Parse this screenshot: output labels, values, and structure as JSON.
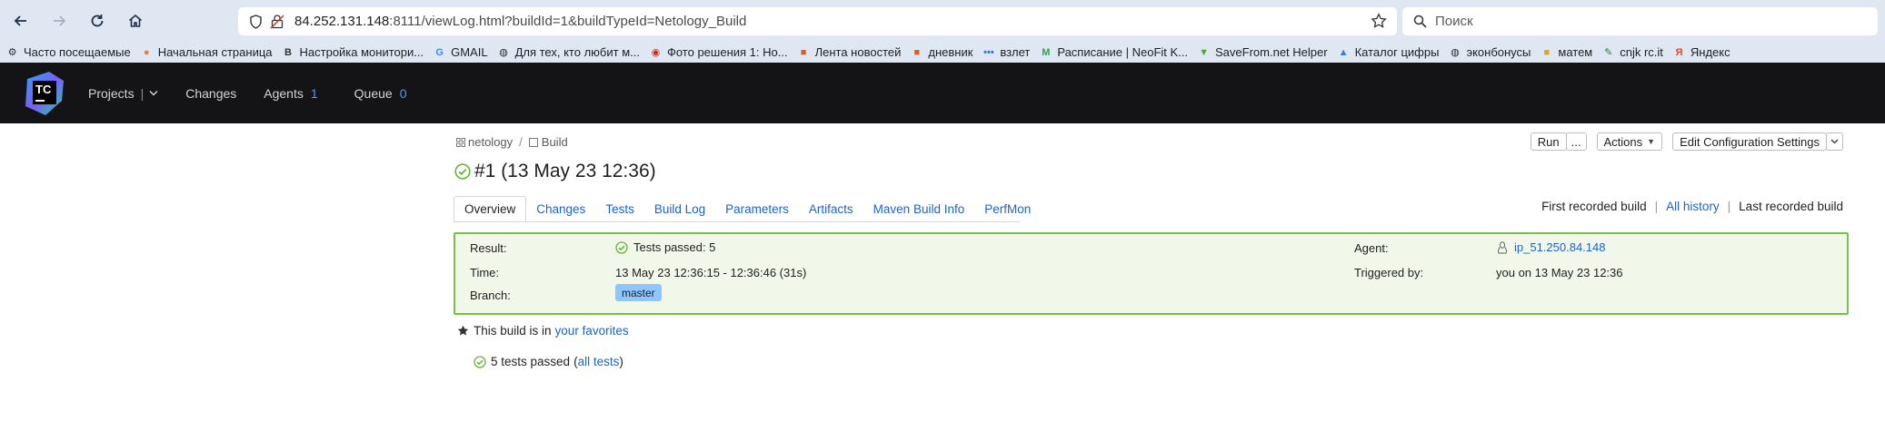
{
  "browser": {
    "url_host": "84.252.131.148",
    "url_rest": ":8111/viewLog.html?buildId=1&buildTypeId=Netology_Build",
    "search_placeholder": "Поиск"
  },
  "bookmarks": [
    {
      "label": "Часто посещаемые",
      "icon": "gear-icon",
      "color": "#2b2b2b"
    },
    {
      "label": "Начальная страница",
      "icon": "firefox-icon",
      "color": "#ff7139"
    },
    {
      "label": "Настройка монитори...",
      "icon": "b-icon",
      "color": "#333333"
    },
    {
      "label": "GMAIL",
      "icon": "google-icon",
      "color": "#4285f4"
    },
    {
      "label": "Для тех, кто любит м...",
      "icon": "globe-icon",
      "color": "#2b2b2b"
    },
    {
      "label": "Фото решения 1: Но...",
      "icon": "flag-icon",
      "color": "#d52b1e"
    },
    {
      "label": "Лента новостей",
      "icon": "news-icon",
      "color": "#e05a2b"
    },
    {
      "label": "дневник",
      "icon": "diary-icon",
      "color": "#e05a2b"
    },
    {
      "label": "взлет",
      "icon": "dots-icon",
      "color": "#3a6fd8"
    },
    {
      "label": "Расписание | NeoFit K...",
      "icon": "neofit-icon",
      "color": "#2ea44f"
    },
    {
      "label": "SaveFrom.net Helper",
      "icon": "download-icon",
      "color": "#4caf20"
    },
    {
      "label": "Каталог цифры",
      "icon": "catalog-icon",
      "color": "#3a7bd5"
    },
    {
      "label": "эконбонусы",
      "icon": "globe-icon",
      "color": "#2b2b2b"
    },
    {
      "label": "матем",
      "icon": "math-icon",
      "color": "#e0a800"
    },
    {
      "label": "cnjk rc.it",
      "icon": "leaf-icon",
      "color": "#2e7d32"
    },
    {
      "label": "Яндекс",
      "icon": "yandex-icon",
      "color": "#fc3f1d"
    }
  ],
  "teamcity": {
    "logo_text": "TC",
    "nav": {
      "projects": "Projects",
      "separator": "|",
      "changes": "Changes",
      "agents": "Agents",
      "agents_count": "1",
      "queue": "Queue",
      "queue_count": "0"
    }
  },
  "breadcrumb": {
    "project": "netology",
    "separator": "/",
    "build_config": "Build"
  },
  "build": {
    "title": "#1 (13 May 23 12:36)",
    "status_color": "#5fb832"
  },
  "top_buttons": {
    "run": "Run",
    "run_more": "...",
    "actions": "Actions",
    "edit": "Edit Configuration Settings"
  },
  "tabs": [
    {
      "label": "Overview",
      "active": true
    },
    {
      "label": "Changes",
      "active": false
    },
    {
      "label": "Tests",
      "active": false
    },
    {
      "label": "Build Log",
      "active": false
    },
    {
      "label": "Parameters",
      "active": false
    },
    {
      "label": "Artifacts",
      "active": false
    },
    {
      "label": "Maven Build Info",
      "active": false
    },
    {
      "label": "PerfMon",
      "active": false
    }
  ],
  "history_links": {
    "first": "First recorded build",
    "sep": "|",
    "all": "All history",
    "last": "Last recorded build"
  },
  "summary": {
    "result_label": "Result:",
    "result_value": "Tests passed: 5",
    "time_label": "Time:",
    "time_value": "13 May 23 12:36:15 - 12:36:46 (31s)",
    "branch_label": "Branch:",
    "branch_value": "master",
    "agent_label": "Agent:",
    "agent_value": "ip_51.250.84.148",
    "triggered_label": "Triggered by:",
    "triggered_value": "you on 13 May 23 12:36"
  },
  "favorites": {
    "prefix": "This build is in",
    "link": "your favorites"
  },
  "tests_summary": {
    "text": "5 tests passed",
    "open_paren": "(",
    "link": "all tests",
    "close_paren": ")"
  }
}
